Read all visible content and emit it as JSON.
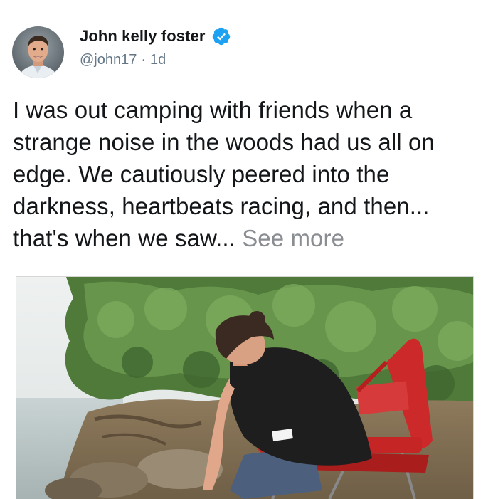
{
  "author": {
    "display_name": "John kelly foster",
    "handle": "@john17",
    "separator": "·",
    "time_ago": "1d",
    "verified": true
  },
  "tweet": {
    "text": "I was out camping with friends when a strange noise in the woods had us all on edge. We cautiously peered into the darkness, heartbeats racing, and then... that's when we saw...",
    "see_more": "See more"
  },
  "colors": {
    "verified": "#1da1f2",
    "secondary_text": "#657786",
    "see_more": "#8a8d91",
    "primary_text": "#14171a"
  },
  "icons": {
    "verified": "verified-badge-icon"
  }
}
